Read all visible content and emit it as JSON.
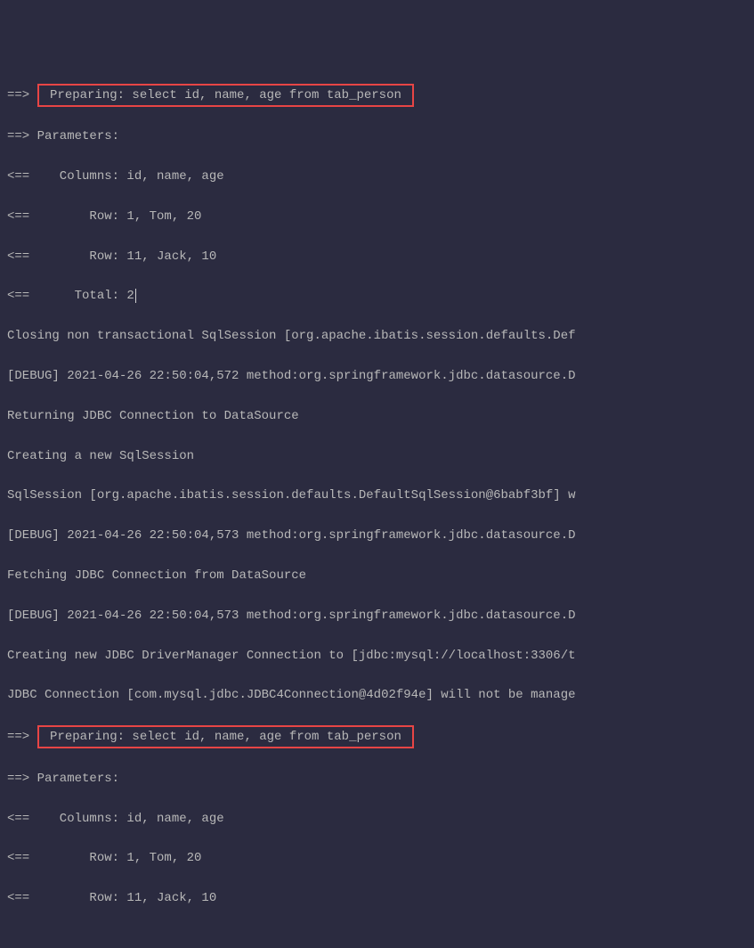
{
  "lines": {
    "l1_prefix": "==> ",
    "l1_highlight": " Preparing: select id, name, age from tab_person ",
    "l2": "==> Parameters:",
    "l3": "<==    Columns: id, name, age",
    "l4": "<==        Row: 1, Tom, 20",
    "l5": "<==        Row: 11, Jack, 10",
    "l6": "<==      Total: 2",
    "l7": "Closing non transactional SqlSession [org.apache.ibatis.session.defaults.Def",
    "l8": "[DEBUG] 2021-04-26 22:50:04,572 method:org.springframework.jdbc.datasource.D",
    "l9": "Returning JDBC Connection to DataSource",
    "l10": "Creating a new SqlSession",
    "l11": "SqlSession [org.apache.ibatis.session.defaults.DefaultSqlSession@6babf3bf] w",
    "l12": "[DEBUG] 2021-04-26 22:50:04,573 method:org.springframework.jdbc.datasource.D",
    "l13": "Fetching JDBC Connection from DataSource",
    "l14": "[DEBUG] 2021-04-26 22:50:04,573 method:org.springframework.jdbc.datasource.D",
    "l15": "Creating new JDBC DriverManager Connection to [jdbc:mysql://localhost:3306/t",
    "l16": "JDBC Connection [com.mysql.jdbc.JDBC4Connection@4d02f94e] will not be manage",
    "l17_prefix": "==> ",
    "l17_highlight": " Preparing: select id, name, age from tab_person ",
    "l18": "==> Parameters:",
    "l19": "<==    Columns: id, name, age",
    "l20": "<==        Row: 1, Tom, 20",
    "l21": "<==        Row: 11, Jack, 10"
  }
}
